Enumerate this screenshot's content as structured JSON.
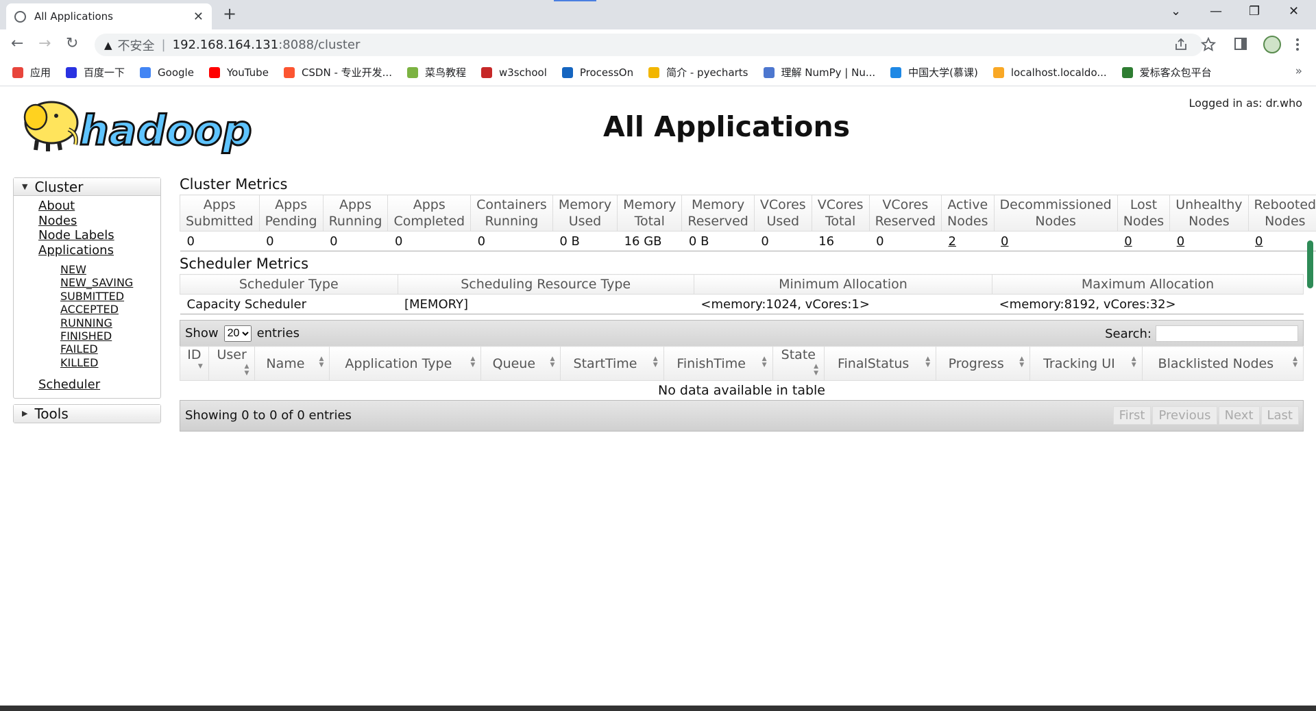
{
  "browser": {
    "tab_title": "All Applications",
    "tab_close": "✕",
    "new_tab": "+",
    "window_controls": [
      "⌄",
      "—",
      "❐",
      "✕"
    ],
    "nav_icons": [
      "←",
      "→",
      "↻"
    ],
    "warning_icon": "▲",
    "insecure_label": "不安全",
    "separator": "|",
    "url_host": "192.168.164.131",
    "url_path": ":8088/cluster",
    "toolbar_icons": [
      "share-icon",
      "star-icon",
      "sidebar-icon",
      "menu-icon"
    ],
    "bookmarks": [
      {
        "label": "应用",
        "color": "#e8453c"
      },
      {
        "label": "百度一下",
        "color": "#2932e1"
      },
      {
        "label": "Google",
        "color": "#4285f4"
      },
      {
        "label": "YouTube",
        "color": "#ff0000"
      },
      {
        "label": "CSDN - 专业开发...",
        "color": "#fc5531"
      },
      {
        "label": "菜鸟教程",
        "color": "#7cb342"
      },
      {
        "label": "w3school",
        "color": "#c62828"
      },
      {
        "label": "ProcessOn",
        "color": "#1565c0"
      },
      {
        "label": "简介 - pyecharts",
        "color": "#f2b600"
      },
      {
        "label": "理解 NumPy | Nu...",
        "color": "#4d77cf"
      },
      {
        "label": "中国大学(慕课)",
        "color": "#1e88e5"
      },
      {
        "label": "localhost.localdo...",
        "color": "#f9a825"
      },
      {
        "label": "爱标客众包平台",
        "color": "#2e7d32"
      }
    ],
    "bookmarks_more": "»"
  },
  "header": {
    "logo_text": "hadoop",
    "logged_in": "Logged in as: dr.who",
    "title": "All Applications"
  },
  "nav": {
    "cluster_label": "Cluster",
    "cluster_links": [
      "About",
      "Nodes",
      "Node Labels",
      "Applications"
    ],
    "app_states": [
      "NEW",
      "NEW_SAVING",
      "SUBMITTED",
      "ACCEPTED",
      "RUNNING",
      "FINISHED",
      "FAILED",
      "KILLED"
    ],
    "scheduler_link": "Scheduler",
    "tools_label": "Tools"
  },
  "cluster_metrics": {
    "title": "Cluster Metrics",
    "headers": [
      [
        "Apps",
        "Submitted"
      ],
      [
        "Apps",
        "Pending"
      ],
      [
        "Apps",
        "Running"
      ],
      [
        "Apps",
        "Completed"
      ],
      [
        "Containers",
        "Running"
      ],
      [
        "Memory",
        "Used"
      ],
      [
        "Memory",
        "Total"
      ],
      [
        "Memory",
        "Reserved"
      ],
      [
        "VCores",
        "Used"
      ],
      [
        "VCores",
        "Total"
      ],
      [
        "VCores",
        "Reserved"
      ],
      [
        "Active",
        "Nodes"
      ],
      [
        "Decommissioned",
        "Nodes"
      ],
      [
        "Lost",
        "Nodes"
      ],
      [
        "Unhealthy",
        "Nodes"
      ],
      [
        "Rebooted",
        "Nodes"
      ]
    ],
    "values": [
      "0",
      "0",
      "0",
      "0",
      "0",
      "0 B",
      "16 GB",
      "0 B",
      "0",
      "16",
      "0",
      "2",
      "0",
      "0",
      "0",
      "0"
    ]
  },
  "scheduler_metrics": {
    "title": "Scheduler Metrics",
    "headers": [
      "Scheduler Type",
      "Scheduling Resource Type",
      "Minimum Allocation",
      "Maximum Allocation"
    ],
    "values": [
      "Capacity Scheduler",
      "[MEMORY]",
      "<memory:1024, vCores:1>",
      "<memory:8192, vCores:32>"
    ]
  },
  "apps_table": {
    "show_label": "Show",
    "show_value": "20",
    "entries_label": "entries",
    "search_label": "Search:",
    "columns": [
      "ID",
      "User",
      "Name",
      "Application Type",
      "Queue",
      "StartTime",
      "FinishTime",
      "State",
      "FinalStatus",
      "Progress",
      "Tracking UI",
      "Blacklisted Nodes"
    ],
    "empty_message": "No data available in table",
    "info": "Showing 0 to 0 of 0 entries",
    "pager": [
      "First",
      "Previous",
      "Next",
      "Last"
    ]
  }
}
